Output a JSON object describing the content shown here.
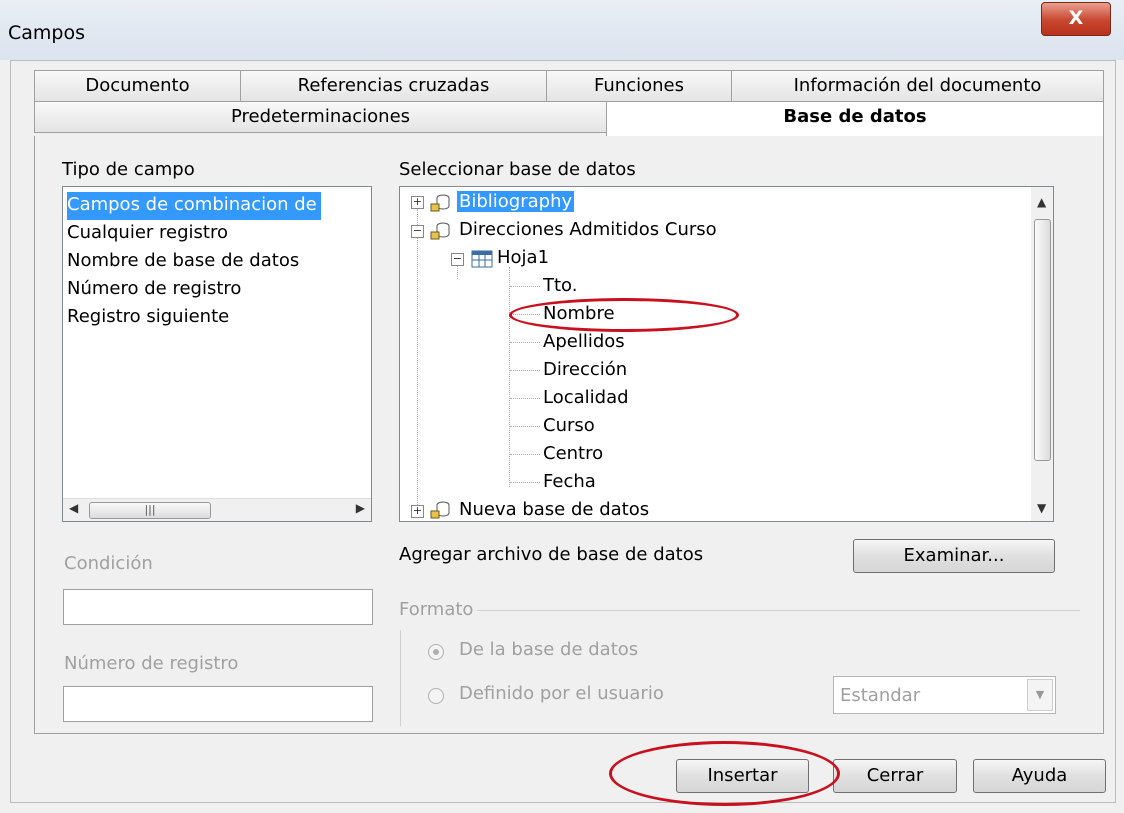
{
  "window": {
    "title": "Campos",
    "close_glyph": "X"
  },
  "tabs_row1": [
    "Documento",
    "Referencias cruzadas",
    "Funciones",
    "Información del documento"
  ],
  "tabs_row2": [
    "Predeterminaciones",
    "Base de datos"
  ],
  "active_tab": "Base de datos",
  "tipo_campo": {
    "label": "Tipo de campo",
    "items": [
      "Campos de combinacion de",
      "Cualquier registro",
      "Nombre de base de datos",
      "Número de registro",
      "Registro siguiente"
    ],
    "selected": "Campos de combinacion de"
  },
  "seleccionar": {
    "label": "Seleccionar base de datos",
    "tree": {
      "bibliography": "Bibliography",
      "direcciones": "Direcciones Admitidos Curso",
      "hoja": "Hoja1",
      "fields": [
        "Tto.",
        "Nombre",
        "Apellidos",
        "Dirección",
        "Localidad",
        "Curso",
        "Centro",
        "Fecha"
      ],
      "nueva": "Nueva base de datos"
    },
    "highlighted_field": "Nombre"
  },
  "condicion": {
    "label": "Condición",
    "value": ""
  },
  "numero_registro": {
    "label": "Número de registro",
    "value": ""
  },
  "agregar_label": "Agregar archivo de base de datos",
  "examinar_button": "Examinar...",
  "formato": {
    "label": "Formato",
    "option1": "De la base de datos",
    "option2": "Definido por el usuario",
    "combo_value": "Estandar"
  },
  "buttons": {
    "insertar": "Insertar",
    "cerrar": "Cerrar",
    "ayuda": "Ayuda"
  },
  "colors": {
    "selection": "#3399ff",
    "annotation": "#c8101e"
  }
}
